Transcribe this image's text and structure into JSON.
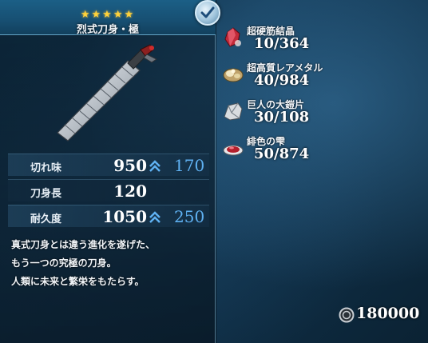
{
  "weapon": {
    "rarity_stars": "★★★★★",
    "name": "烈式刀身・極",
    "stats": [
      {
        "label": "切れ味",
        "value": "950",
        "bonus": "170"
      },
      {
        "label": "刀身長",
        "value": "120",
        "bonus": ""
      },
      {
        "label": "耐久度",
        "value": "1050",
        "bonus": "250"
      }
    ],
    "description": [
      "真式刀身とは違う進化を遂げた、",
      "もう一つの究極の刀身。",
      "人類に未来と繁栄をもたらす。"
    ]
  },
  "materials": [
    {
      "name": "超硬筋結晶",
      "count": "10/364",
      "icon": "red-crystal-icon"
    },
    {
      "name": "超高質レアメタル",
      "count": "40/984",
      "icon": "rare-metal-icon"
    },
    {
      "name": "巨人の大鎧片",
      "count": "30/108",
      "icon": "armor-shard-icon"
    },
    {
      "name": "緋色の雫",
      "count": "50/874",
      "icon": "scarlet-drop-icon"
    }
  ],
  "currency": {
    "amount": "180000",
    "icon": "coin-icon"
  },
  "colors": {
    "bonus": "#5fb1f2",
    "stars": "#ffd23a",
    "panel_border": "#8cc8eb"
  }
}
